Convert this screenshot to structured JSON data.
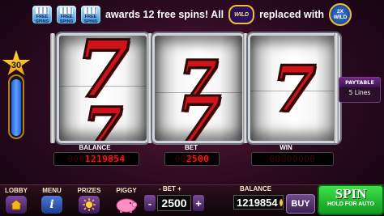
{
  "banner": {
    "free_spin_badge_text": "FREE SPINS",
    "message_part1": "awards 12 free spins! All",
    "wild_chip": "WILD",
    "message_part2": "replaced with",
    "wild_2x_chip_top": "2X",
    "wild_2x_chip_bottom": "WILD"
  },
  "level": {
    "value": "30",
    "progress_fraction": 0.92
  },
  "reels": [
    {
      "symbols": [
        "7",
        "7"
      ]
    },
    {
      "symbols": [
        "7",
        "7"
      ]
    },
    {
      "symbols": [
        "7"
      ]
    }
  ],
  "paytable": {
    "button_label": "PAYTABLE",
    "lines_text": "5 Lines"
  },
  "info": {
    "balance_label": "BALANCE",
    "balance_led_dim": "000",
    "balance_led": "1219854",
    "bet_label": "BET",
    "bet_led_dim": "00",
    "bet_led": "2500",
    "win_label": "WIN",
    "win_led_dim": "00000000"
  },
  "bottom": {
    "lobby_label": "LOBBY",
    "menu_label": "MENU",
    "prizes_label": "PRIZES",
    "piggy_label": "PIGGY",
    "bet_header": "- BET +",
    "bet_minus": "-",
    "bet_value": "2500",
    "bet_plus": "+",
    "balance_header": "BALANCE",
    "balance_value": "1219854",
    "buy_label": "BUY",
    "spin_label": "SPIN",
    "spin_sub": "HOLD FOR AUTO"
  },
  "colors": {
    "led": "#ff2020",
    "spin_green": "#1fbf2e",
    "gold": "#f0c032",
    "seven_red": "#d0121b"
  }
}
